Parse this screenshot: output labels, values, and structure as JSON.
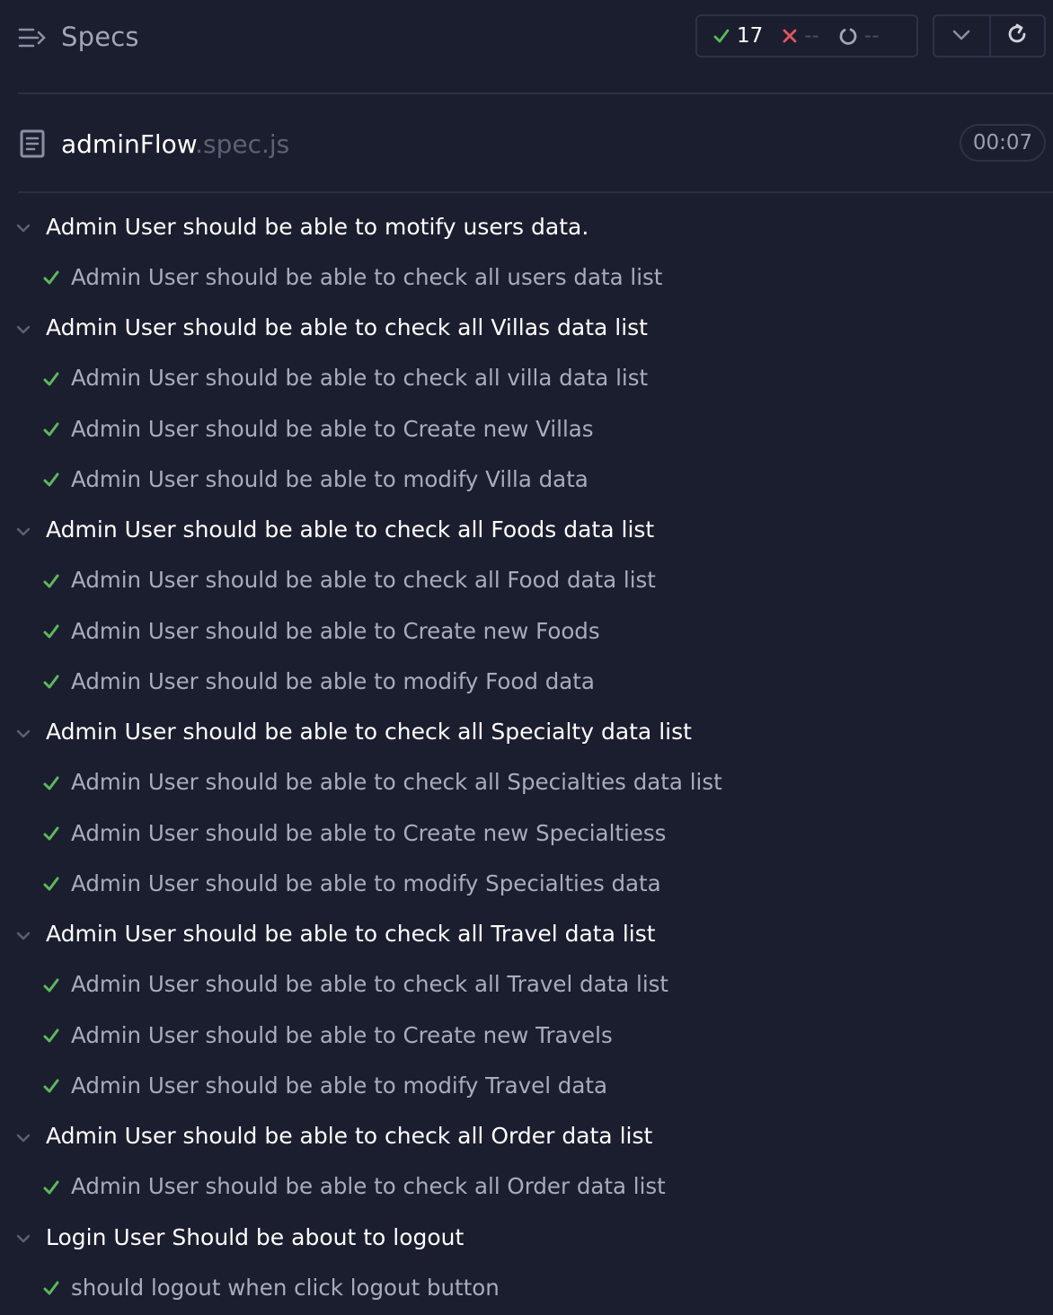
{
  "header": {
    "title": "Specs",
    "stats": {
      "passed": "17",
      "failed": "--",
      "pending": "--"
    },
    "colors": {
      "passed": "#5cb85c",
      "failed": "#e05561",
      "pending": "#a1a5b7"
    }
  },
  "file": {
    "base": "adminFlow",
    "ext": ".spec.js",
    "duration": "00:07"
  },
  "suites": [
    {
      "title": "Admin User should be able to motify users data.",
      "tests": [
        "Admin User should be able to check all users data list"
      ]
    },
    {
      "title": "Admin User should be able to check all Villas data list",
      "tests": [
        "Admin User should be able to check all villa data list",
        "Admin User should be able to Create new Villas",
        "Admin User should be able to modify Villa data"
      ]
    },
    {
      "title": "Admin User should be able to check all Foods data list",
      "tests": [
        "Admin User should be able to check all Food data list",
        "Admin User should be able to Create new Foods",
        "Admin User should be able to modify Food data"
      ]
    },
    {
      "title": "Admin User should be able to check all Specialty data list",
      "tests": [
        "Admin User should be able to check all Specialties data list",
        "Admin User should be able to Create new Specialtiess",
        "Admin User should be able to modify Specialties data"
      ]
    },
    {
      "title": "Admin User should be able to check all Travel data list",
      "tests": [
        "Admin User should be able to check all Travel data list",
        "Admin User should be able to Create new Travels",
        "Admin User should be able to modify Travel data"
      ]
    },
    {
      "title": "Admin User should be able to check all Order data list",
      "tests": [
        "Admin User should be able to check all Order data list"
      ]
    },
    {
      "title": "Login User Should be about to logout",
      "tests": [
        "should logout when click logout button"
      ]
    }
  ]
}
